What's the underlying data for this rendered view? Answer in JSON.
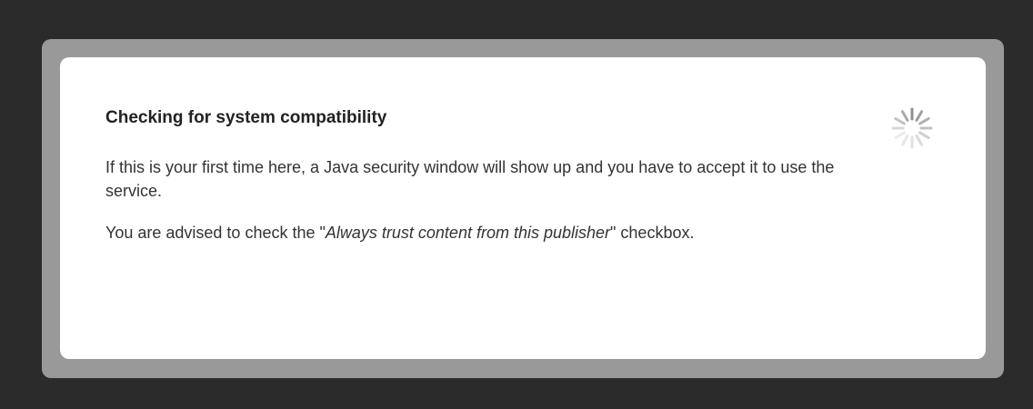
{
  "dialog": {
    "title": "Checking for system compatibility",
    "paragraph1": "If this is your first time here, a Java security window will show up and you have to accept it to use the service.",
    "paragraph2_prefix": "You are advised to check the \"",
    "paragraph2_emphasis": "Always trust content from this publisher",
    "paragraph2_suffix": "\" checkbox.",
    "spinner_icon": "loading-spinner-icon"
  },
  "colors": {
    "page_background": "#2b2b2b",
    "frame": "#999999",
    "panel": "#ffffff",
    "text": "#333333"
  }
}
